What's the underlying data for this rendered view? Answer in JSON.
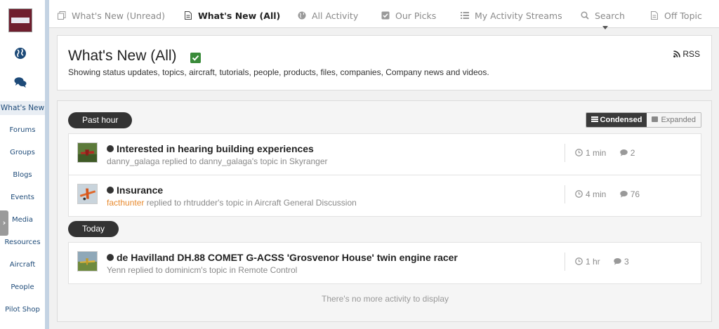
{
  "sidebar": {
    "items": [
      {
        "label": "What's New",
        "active": true
      },
      {
        "label": "Forums"
      },
      {
        "label": "Groups"
      },
      {
        "label": "Blogs"
      },
      {
        "label": "Events"
      },
      {
        "label": "Media"
      },
      {
        "label": "Resources"
      },
      {
        "label": "Aircraft"
      },
      {
        "label": "People"
      },
      {
        "label": "Pilot Shop"
      }
    ]
  },
  "tabs": [
    {
      "label": "What's New (Unread)",
      "icon": "copy-icon"
    },
    {
      "label": "What's New (All)",
      "icon": "file-icon",
      "active": true
    },
    {
      "label": "All Activity",
      "icon": "globe-icon"
    },
    {
      "label": "Our Picks",
      "icon": "check-square-icon"
    },
    {
      "label": "My Activity Streams",
      "icon": "list-icon"
    },
    {
      "label": "Search",
      "icon": "search-icon"
    },
    {
      "label": "Off Topic",
      "icon": "file-icon"
    }
  ],
  "header": {
    "title": "What's New (All)",
    "description": "Showing status updates, topics, aircraft, tutorials, people, products, files, companies, Company news and videos.",
    "rss_label": "RSS"
  },
  "stream": {
    "view_modes": {
      "condensed": "Condensed",
      "expanded": "Expanded"
    },
    "groups": [
      {
        "label": "Past hour",
        "items": [
          {
            "title": "Interested in hearing building experiences",
            "author": "danny_galaga",
            "subtitle": " replied to danny_galaga's topic in Skyranger",
            "time": "1 min",
            "replies": "2"
          },
          {
            "title": "Insurance",
            "author": "facthunter",
            "subtitle": " replied to rhtrudder's topic in Aircraft General Discussion",
            "time": "4 min",
            "replies": "76"
          }
        ]
      },
      {
        "label": "Today",
        "items": [
          {
            "title": "de Havilland DH.88 COMET G-ACSS 'Grosvenor House' twin engine racer",
            "author": "Yenn",
            "subtitle": " replied to dominicm's topic in Remote Control",
            "time": "1 hr",
            "replies": "3"
          }
        ]
      }
    ],
    "no_more_text": "There's no more activity to display"
  },
  "colors": {
    "accent_link": "#1d4a78",
    "highlight_author": "#e88a2e",
    "check_green": "#3a8b3a",
    "pill_dark": "#333333"
  }
}
